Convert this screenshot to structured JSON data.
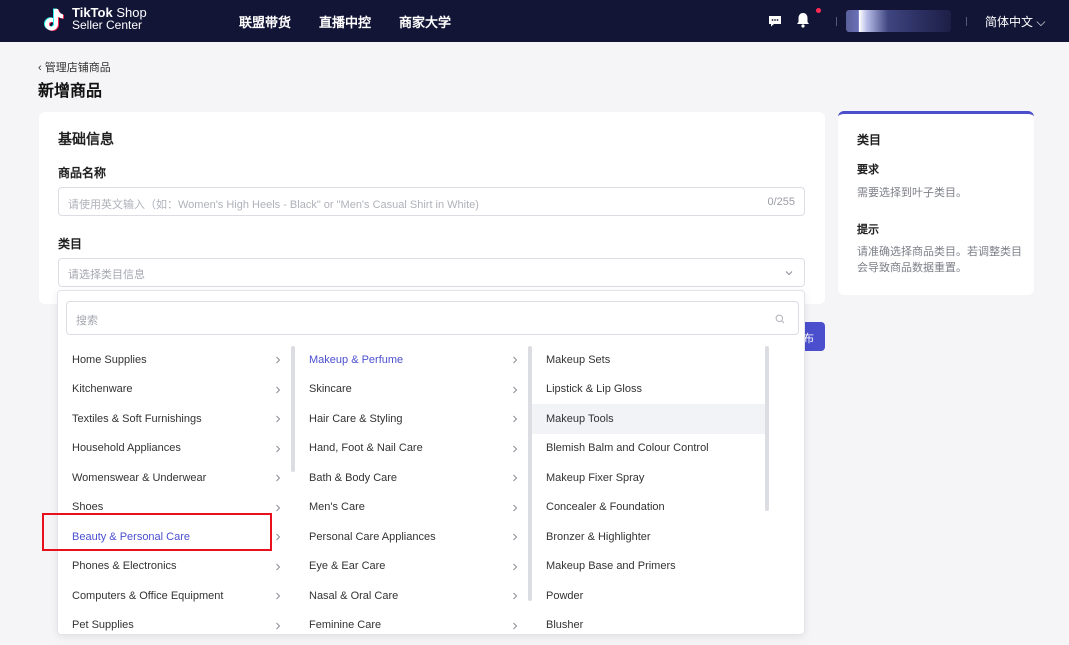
{
  "topbar": {
    "logo_line1_bold": "TikTok",
    "logo_line1_rest": " Shop",
    "logo_line2": "Seller Center",
    "nav": [
      "联盟带货",
      "直播中控",
      "商家大学"
    ],
    "language": "简体中文 ⌵"
  },
  "breadcrumb": "‹ 管理店铺商品",
  "page_title": "新增商品",
  "form": {
    "section_title": "基础信息",
    "name_label": "商品名称",
    "name_placeholder": "请使用英文输入（如：Women's High Heels - Black\" or \"Men's Casual Shirt in White)",
    "name_count": "0/255",
    "category_label": "类目",
    "category_placeholder": "请选择类目信息"
  },
  "help": {
    "title": "类目",
    "req_title": "要求",
    "req_text": "需要选择到叶子类目。",
    "tip_title": "提示",
    "tip_text": "请准确选择商品类目。若调整类目会导致商品数据重置。"
  },
  "publish_fragment": "布",
  "dropdown": {
    "search_placeholder": "搜索",
    "col1": [
      "Home Supplies",
      "Kitchenware",
      "Textiles & Soft Furnishings",
      "Household Appliances",
      "Womenswear & Underwear",
      "Shoes",
      "Beauty & Personal Care",
      "Phones & Electronics",
      "Computers & Office Equipment",
      "Pet Supplies"
    ],
    "col2": [
      "Makeup & Perfume",
      "Skincare",
      "Hair Care & Styling",
      "Hand, Foot & Nail Care",
      "Bath & Body Care",
      "Men's Care",
      "Personal Care Appliances",
      "Eye & Ear Care",
      "Nasal & Oral Care",
      "Feminine Care"
    ],
    "col3": [
      "Makeup Sets",
      "Lipstick & Lip Gloss",
      "Makeup Tools",
      "Blemish Balm and Colour Control",
      "Makeup Fixer Spray",
      "Concealer & Foundation",
      "Bronzer & Highlighter",
      "Makeup Base and Primers",
      "Powder",
      "Blusher"
    ]
  },
  "colors": {
    "accent": "#4b4fce",
    "topbar": "#121536",
    "highlight": "#e8101c"
  }
}
